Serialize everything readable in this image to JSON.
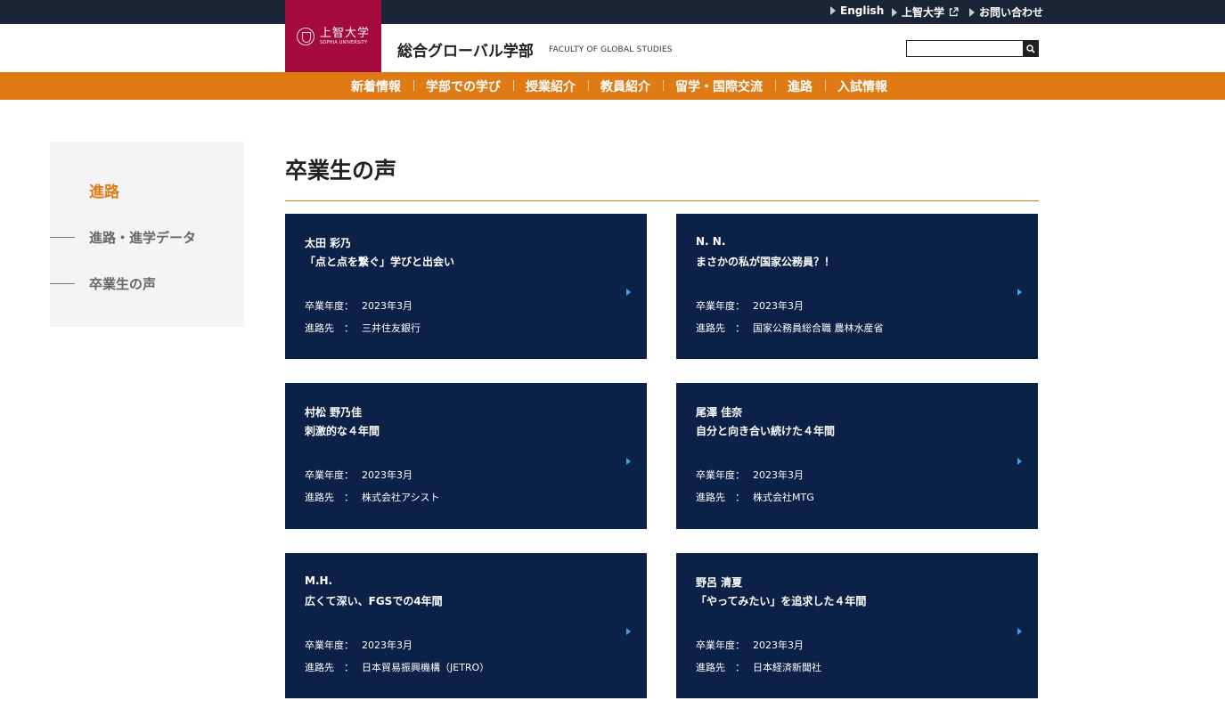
{
  "topbar": {
    "links": [
      {
        "label": "English"
      },
      {
        "label": "上智大学"
      },
      {
        "label": "お問い合わせ"
      }
    ]
  },
  "header": {
    "logo_jp": "上智大学",
    "logo_en": "SOPHIA UNIVERSITY",
    "faculty_jp": "総合グローバル学部",
    "faculty_en": "FACULTY OF GLOBAL STUDIES",
    "search_value": ""
  },
  "nav": {
    "items": [
      "新着情報",
      "学部での学び",
      "授業紹介",
      "教員紹介",
      "留学・国際交流",
      "進路",
      "入試情報"
    ]
  },
  "sidebar": {
    "title": "進路",
    "items": [
      "進路・進学データ",
      "卒業生の声"
    ]
  },
  "main": {
    "title": "卒業生の声",
    "year_key": "卒業年度：",
    "dest_key": "進路先　：",
    "cards": [
      {
        "name": "太田 彩乃",
        "headline": "「点と点を繋ぐ」学びと出会い",
        "year": "2023年3月",
        "destination": "三井住友銀行"
      },
      {
        "name": "N. N.",
        "headline": "まさかの私が国家公務員？！",
        "year": "2023年3月",
        "destination": "国家公務員総合職 農林水産省"
      },
      {
        "name": "村松 野乃佳",
        "headline": "刺激的な４年間",
        "year": "2023年3月",
        "destination": "株式会社アシスト"
      },
      {
        "name": "尾澤 佳奈",
        "headline": "自分と向き合い続けた４年間",
        "year": "2023年3月",
        "destination": "株式会社MTG"
      },
      {
        "name": "M.H.",
        "headline": "広くて深い、FGSでの4年間",
        "year": "2023年3月",
        "destination": "日本貿易振興機構（JETRO）"
      },
      {
        "name": "野呂 清夏",
        "headline": "「やってみたい」を追求した４年間",
        "year": "2023年3月",
        "destination": "日本経済新聞社"
      }
    ]
  },
  "colors": {
    "topbar": "#1c2437",
    "logo": "#a50a3f",
    "accent": "#df7a14",
    "card": "#0c2148",
    "chevron": "#3aa3ee"
  }
}
